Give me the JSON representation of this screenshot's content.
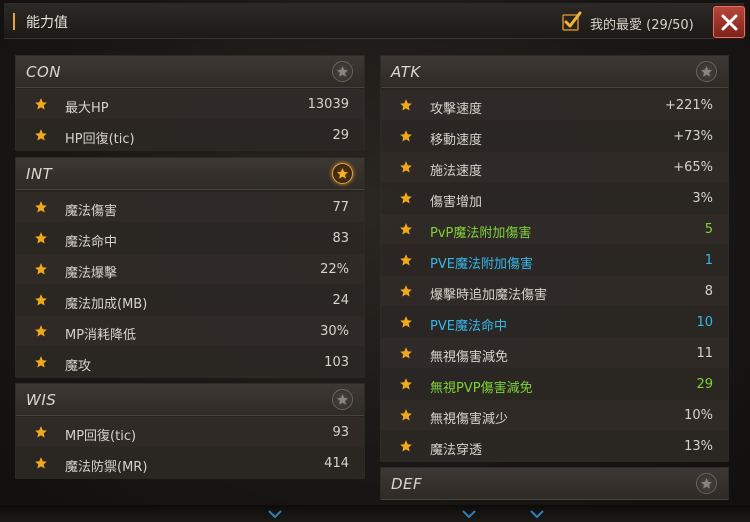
{
  "window": {
    "title": "能力值",
    "favorites_label": "我的最愛 (29/50)",
    "accent": "#e8a23a"
  },
  "left_sections": [
    {
      "name": "CON",
      "favorited": false,
      "rows": [
        {
          "label": "最大HP",
          "value": "13039"
        },
        {
          "label": "HP回復(tic)",
          "value": "29"
        }
      ]
    },
    {
      "name": "INT",
      "favorited": true,
      "rows": [
        {
          "label": "魔法傷害",
          "value": "77"
        },
        {
          "label": "魔法命中",
          "value": "83"
        },
        {
          "label": "魔法爆擊",
          "value": "22%"
        },
        {
          "label": "魔法加成(MB)",
          "value": "24"
        },
        {
          "label": "MP消耗降低",
          "value": "30%"
        },
        {
          "label": "魔攻",
          "value": "103"
        }
      ]
    },
    {
      "name": "WIS",
      "favorited": false,
      "rows": [
        {
          "label": "MP回復(tic)",
          "value": "93"
        },
        {
          "label": "魔法防禦(MR)",
          "value": "414"
        }
      ]
    }
  ],
  "right_sections": [
    {
      "name": "ATK",
      "favorited": false,
      "rows": [
        {
          "label": "攻擊速度",
          "value": "+221%",
          "color": "normal"
        },
        {
          "label": "移動速度",
          "value": "+73%",
          "color": "normal"
        },
        {
          "label": "施法速度",
          "value": "+65%",
          "color": "normal"
        },
        {
          "label": "傷害增加",
          "value": "3%",
          "color": "normal"
        },
        {
          "label": "PvP魔法附加傷害",
          "value": "5",
          "color": "green"
        },
        {
          "label": "PVE魔法附加傷害",
          "value": "1",
          "color": "blue"
        },
        {
          "label": "爆擊時追加魔法傷害",
          "value": "8",
          "color": "normal"
        },
        {
          "label": "PVE魔法命中",
          "value": "10",
          "color": "blue"
        },
        {
          "label": "無視傷害減免",
          "value": "11",
          "color": "normal"
        },
        {
          "label": "無視PVP傷害減免",
          "value": "29",
          "color": "green"
        },
        {
          "label": "無視傷害減少",
          "value": "10%",
          "color": "normal"
        },
        {
          "label": "魔法穿透",
          "value": "13%",
          "color": "normal"
        }
      ]
    },
    {
      "name": "DEF",
      "favorited": false,
      "rows": []
    }
  ],
  "colors": {
    "star": "#f0a81c",
    "green_stat": "#7fd13a",
    "blue_stat": "#37b6e8",
    "close_button": "#b8453a"
  },
  "icons": {
    "favorites_checkbox": "check-icon",
    "close": "close-icon",
    "row_star": "star-icon",
    "section_favorite": "star-icon"
  }
}
